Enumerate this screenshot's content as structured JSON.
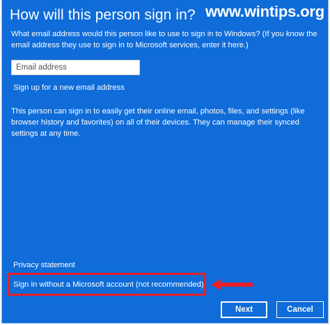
{
  "dialog": {
    "title": "How will this person sign in?",
    "question": "What email address would this person like to use to sign in to Windows? (If you know the email address they use to sign in to Microsoft services, enter it here.)",
    "email_field": {
      "value": "",
      "placeholder": "Email address"
    },
    "signup_link": "Sign up for a new email address",
    "description": "This person can sign in to easily get their online email, photos, files, and settings (like browser history and favorites) on all of their devices. They can manage their synced settings at any time.",
    "privacy_link": "Privacy statement",
    "no_msa_link": "Sign in without a Microsoft account (not recommended)",
    "buttons": {
      "next_label": "Next",
      "cancel_label": "Cancel"
    }
  },
  "watermark": "www.wintips.org",
  "colors": {
    "background": "#0f6cd9",
    "text": "#ffffff",
    "annotation": "#e8202a"
  },
  "icons": {
    "annotation_arrow": "left-arrow-icon"
  }
}
